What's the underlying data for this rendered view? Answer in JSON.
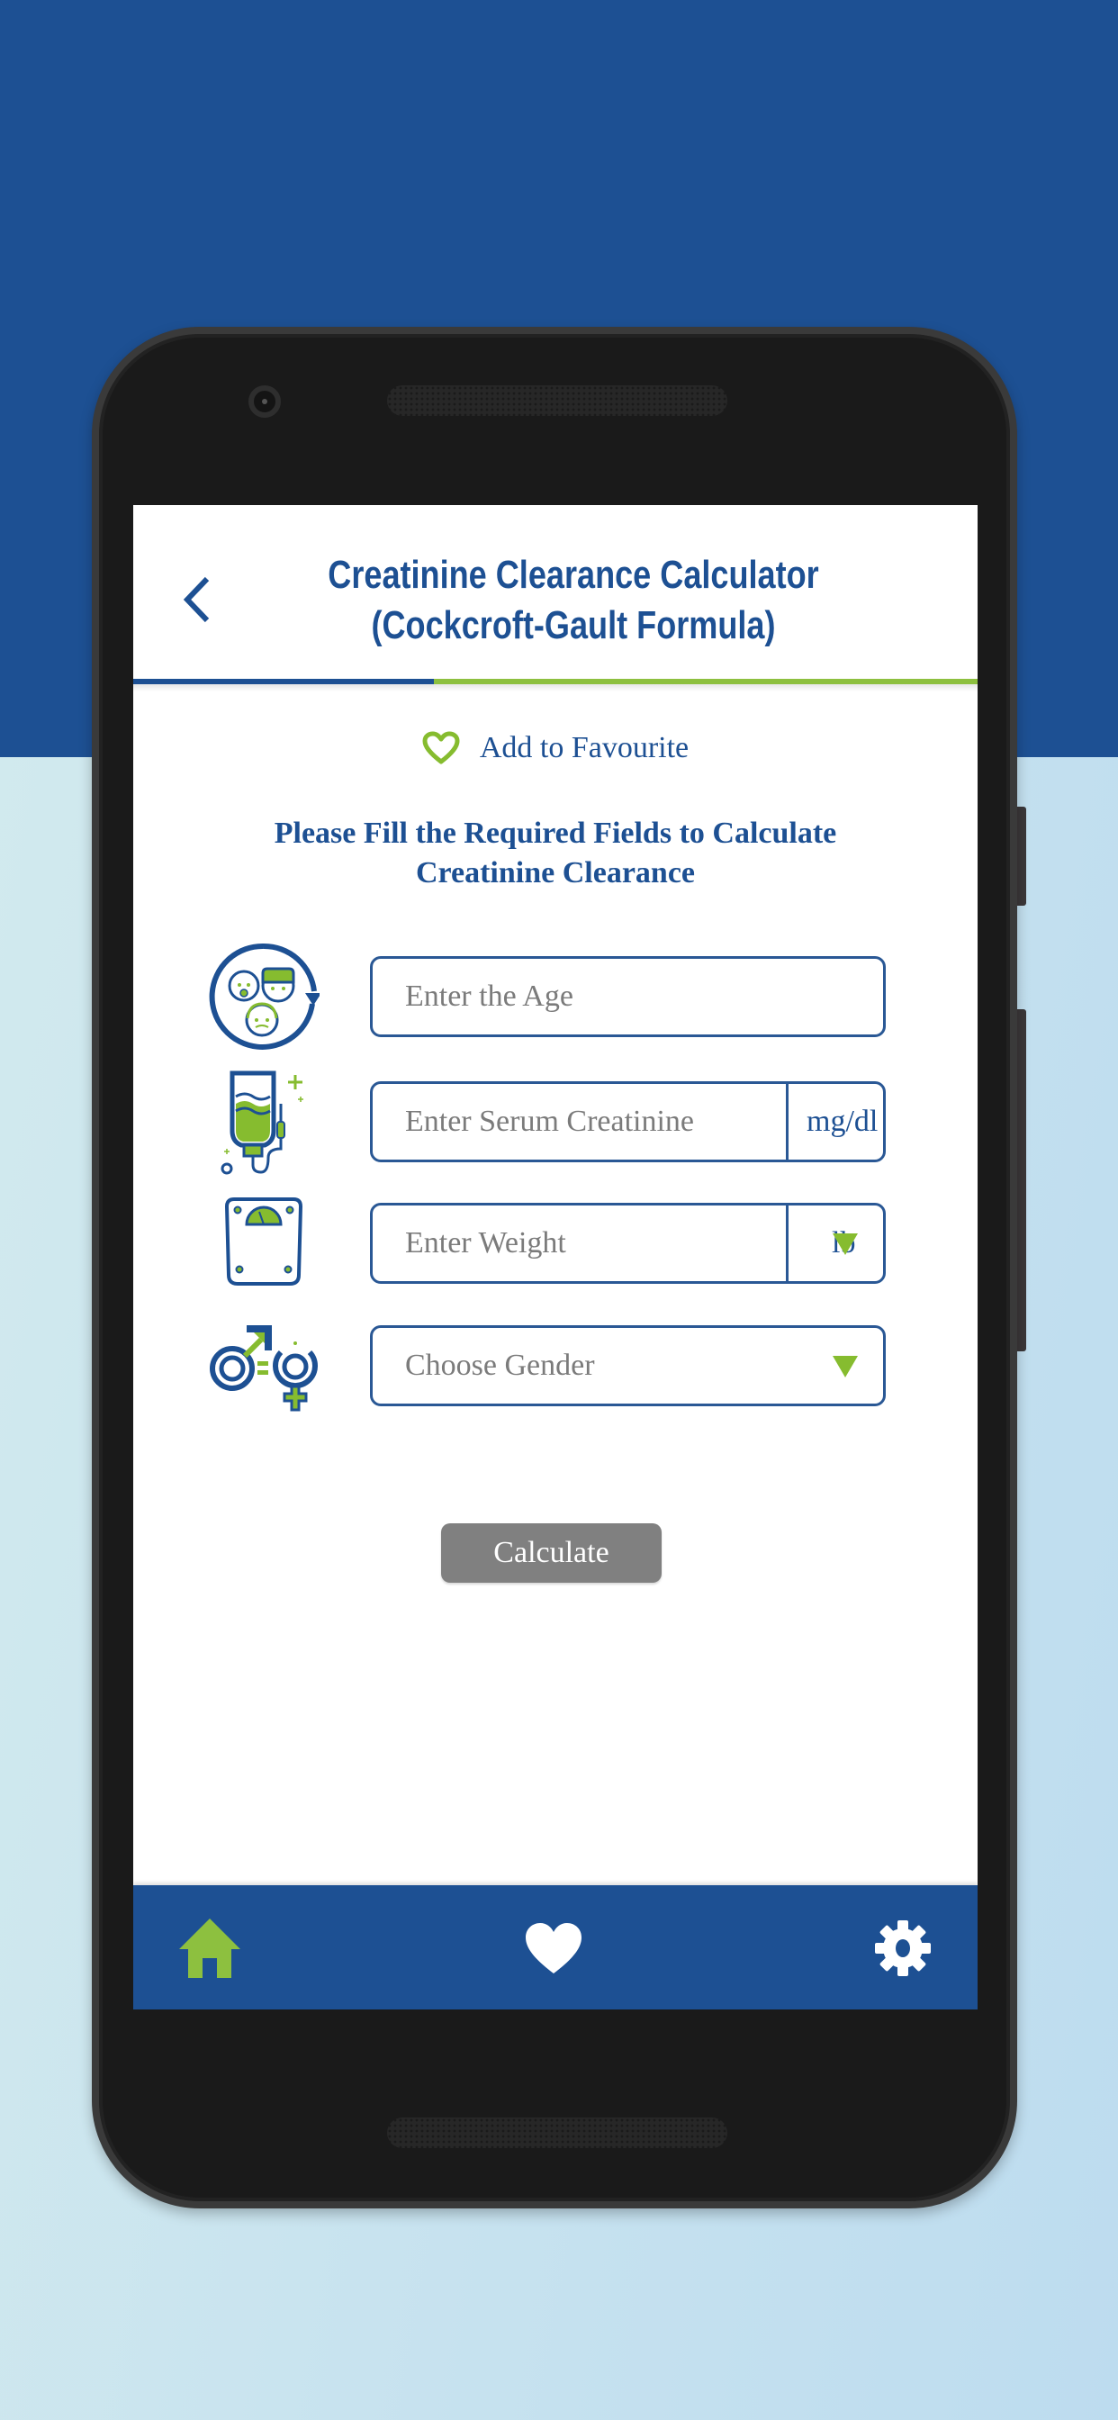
{
  "colors": {
    "brand_blue": "#1d5093",
    "accent_green": "#86bc2f",
    "button_gray": "#808080",
    "placeholder_gray": "#7b7b7b"
  },
  "header": {
    "back_icon": "chevron-left-icon",
    "title_line1": "Creatinine Clearance Calculator",
    "title_line2": "(Cockcroft-Gault Formula)"
  },
  "favourite": {
    "icon": "heart-outline-icon",
    "label": "Add to Favourite"
  },
  "instructions": {
    "line1": "Please Fill the Required Fields to Calculate",
    "line2": "Creatinine Clearance"
  },
  "fields": [
    {
      "icon": "age-cycle-icon",
      "placeholder": "Enter the Age",
      "value": ""
    },
    {
      "icon": "iv-bag-icon",
      "placeholder": "Enter Serum Creatinine",
      "value": "",
      "unit": "mg/dl"
    },
    {
      "icon": "weighing-scale-icon",
      "placeholder": "Enter Weight",
      "value": "",
      "unit": "lb",
      "unit_dropdown": true
    },
    {
      "icon": "gender-icon",
      "placeholder": "Choose Gender",
      "dropdown": true
    }
  ],
  "calculate_label": "Calculate",
  "bottom_nav": [
    {
      "icon": "home-icon",
      "label": "Home",
      "active": true
    },
    {
      "icon": "heart-icon",
      "label": "Favourites",
      "active": false
    },
    {
      "icon": "gear-icon",
      "label": "Settings",
      "active": false
    }
  ]
}
